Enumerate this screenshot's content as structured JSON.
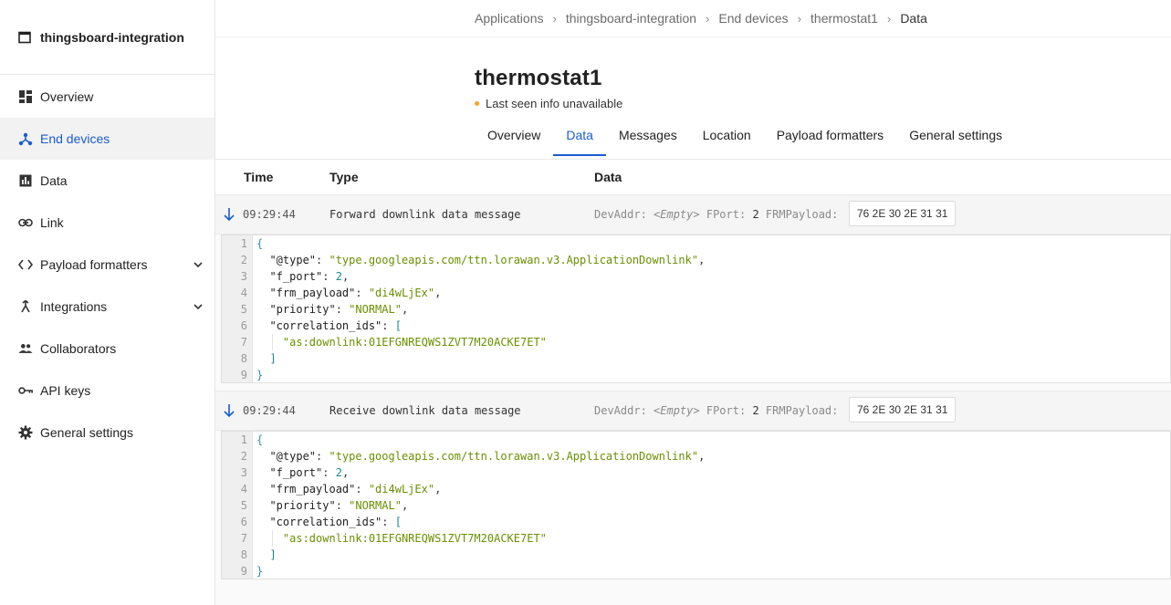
{
  "app": {
    "title": "thingsboard-integration"
  },
  "sidebar": {
    "items": [
      {
        "label": "Overview",
        "icon": "dashboard-icon",
        "active": false,
        "expandable": false
      },
      {
        "label": "End devices",
        "icon": "device-network-icon",
        "active": true,
        "expandable": false
      },
      {
        "label": "Data",
        "icon": "bar-chart-icon",
        "active": false,
        "expandable": false
      },
      {
        "label": "Link",
        "icon": "link-icon",
        "active": false,
        "expandable": false
      },
      {
        "label": "Payload formatters",
        "icon": "code-icon",
        "active": false,
        "expandable": true
      },
      {
        "label": "Integrations",
        "icon": "merge-icon",
        "active": false,
        "expandable": true
      },
      {
        "label": "Collaborators",
        "icon": "people-icon",
        "active": false,
        "expandable": false
      },
      {
        "label": "API keys",
        "icon": "key-icon",
        "active": false,
        "expandable": false
      },
      {
        "label": "General settings",
        "icon": "gear-icon",
        "active": false,
        "expandable": false
      }
    ]
  },
  "breadcrumb": [
    "Applications",
    "thingsboard-integration",
    "End devices",
    "thermostat1",
    "Data"
  ],
  "device": {
    "name": "thermostat1",
    "status": "Last seen info unavailable",
    "status_color": "#f5a623"
  },
  "tabs": [
    {
      "label": "Overview",
      "active": false
    },
    {
      "label": "Data",
      "active": true
    },
    {
      "label": "Messages",
      "active": false
    },
    {
      "label": "Location",
      "active": false
    },
    {
      "label": "Payload formatters",
      "active": false
    },
    {
      "label": "General settings",
      "active": false
    }
  ],
  "table": {
    "headers": {
      "time": "Time",
      "type": "Type",
      "data": "Data"
    },
    "events": [
      {
        "time": "09:29:44",
        "type": "Forward downlink data message",
        "devaddr_label": "DevAddr:",
        "devaddr_value": "<Empty>",
        "fport_label": "FPort:",
        "fport_value": "2",
        "frmpayload_label": "FRMPayload:",
        "frmpayload_value": "76 2E 30 2E 31 31",
        "json": {
          "line1": "{",
          "type_key": "\"@type\"",
          "type_val": "\"type.googleapis.com/ttn.lorawan.v3.ApplicationDownlink\"",
          "fport_key": "\"f_port\"",
          "fport_val": "2",
          "frm_key": "\"frm_payload\"",
          "frm_val": "\"di4wLjEx\"",
          "prio_key": "\"priority\"",
          "prio_val": "\"NORMAL\"",
          "corr_key": "\"correlation_ids\"",
          "open_bracket": "[",
          "corr_val": "\"as:downlink:01EFGNREQWS1ZVT7M20ACKE7ET\"",
          "close_bracket": "]",
          "close_brace": "}"
        }
      },
      {
        "time": "09:29:44",
        "type": "Receive downlink data message",
        "devaddr_label": "DevAddr:",
        "devaddr_value": "<Empty>",
        "fport_label": "FPort:",
        "fport_value": "2",
        "frmpayload_label": "FRMPayload:",
        "frmpayload_value": "76 2E 30 2E 31 31",
        "json": {
          "line1": "{",
          "type_key": "\"@type\"",
          "type_val": "\"type.googleapis.com/ttn.lorawan.v3.ApplicationDownlink\"",
          "fport_key": "\"f_port\"",
          "fport_val": "2",
          "frm_key": "\"frm_payload\"",
          "frm_val": "\"di4wLjEx\"",
          "prio_key": "\"priority\"",
          "prio_val": "\"NORMAL\"",
          "corr_key": "\"correlation_ids\"",
          "open_bracket": "[",
          "corr_val": "\"as:downlink:01EFGNREQWS1ZVT7M20ACKE7ET\"",
          "close_bracket": "]",
          "close_brace": "}"
        }
      }
    ]
  },
  "line_numbers": [
    "1",
    "2",
    "3",
    "4",
    "5",
    "6",
    "7",
    "8",
    "9"
  ],
  "colors": {
    "accent": "#1a5ccf",
    "string": "#6a8f00",
    "number": "#1b8a8a"
  }
}
